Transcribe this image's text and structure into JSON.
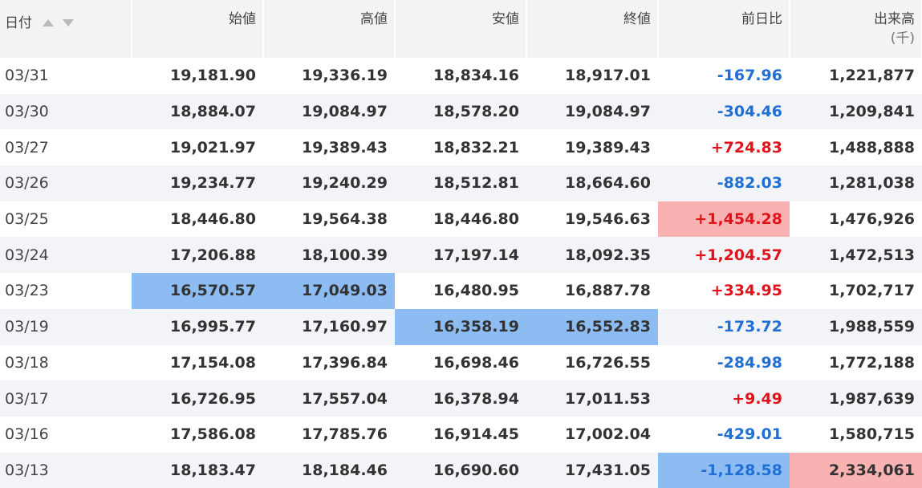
{
  "headers": {
    "date": "日付",
    "open": "始値",
    "high": "高値",
    "low": "安値",
    "close": "終値",
    "change": "前日比",
    "volume": "出来高",
    "volume_unit": "(千)"
  },
  "colors": {
    "header_bg": "#f3f3f3",
    "stripe_bg": "#f3f4f7",
    "negative_text": "#1f6fd4",
    "positive_text": "#e0131c",
    "highlight_blue": "#8dbcf3",
    "highlight_red": "#f8b2b2"
  },
  "rows": [
    {
      "date": "03/31",
      "open": "19,181.90",
      "high": "19,336.19",
      "low": "18,834.16",
      "close": "18,917.01",
      "change": "-167.96",
      "volume": "1,221,877"
    },
    {
      "date": "03/30",
      "open": "18,884.07",
      "high": "19,084.97",
      "low": "18,578.20",
      "close": "19,084.97",
      "change": "-304.46",
      "volume": "1,209,841"
    },
    {
      "date": "03/27",
      "open": "19,021.97",
      "high": "19,389.43",
      "low": "18,832.21",
      "close": "19,389.43",
      "change": "+724.83",
      "volume": "1,488,888"
    },
    {
      "date": "03/26",
      "open": "19,234.77",
      "high": "19,240.29",
      "low": "18,512.81",
      "close": "18,664.60",
      "change": "-882.03",
      "volume": "1,281,038"
    },
    {
      "date": "03/25",
      "open": "18,446.80",
      "high": "19,564.38",
      "low": "18,446.80",
      "close": "19,546.63",
      "change": "+1,454.28",
      "volume": "1,476,926"
    },
    {
      "date": "03/24",
      "open": "17,206.88",
      "high": "18,100.39",
      "low": "17,197.14",
      "close": "18,092.35",
      "change": "+1,204.57",
      "volume": "1,472,513"
    },
    {
      "date": "03/23",
      "open": "16,570.57",
      "high": "17,049.03",
      "low": "16,480.95",
      "close": "16,887.78",
      "change": "+334.95",
      "volume": "1,702,717"
    },
    {
      "date": "03/19",
      "open": "16,995.77",
      "high": "17,160.97",
      "low": "16,358.19",
      "close": "16,552.83",
      "change": "-173.72",
      "volume": "1,988,559"
    },
    {
      "date": "03/18",
      "open": "17,154.08",
      "high": "17,396.84",
      "low": "16,698.46",
      "close": "16,726.55",
      "change": "-284.98",
      "volume": "1,772,188"
    },
    {
      "date": "03/17",
      "open": "16,726.95",
      "high": "17,557.04",
      "low": "16,378.94",
      "close": "17,011.53",
      "change": "+9.49",
      "volume": "1,987,639"
    },
    {
      "date": "03/16",
      "open": "17,586.08",
      "high": "17,785.76",
      "low": "16,914.45",
      "close": "17,002.04",
      "change": "-429.01",
      "volume": "1,580,715"
    },
    {
      "date": "03/13",
      "open": "18,183.47",
      "high": "18,184.46",
      "low": "16,690.60",
      "close": "17,431.05",
      "change": "-1,128.58",
      "volume": "2,334,061"
    }
  ]
}
